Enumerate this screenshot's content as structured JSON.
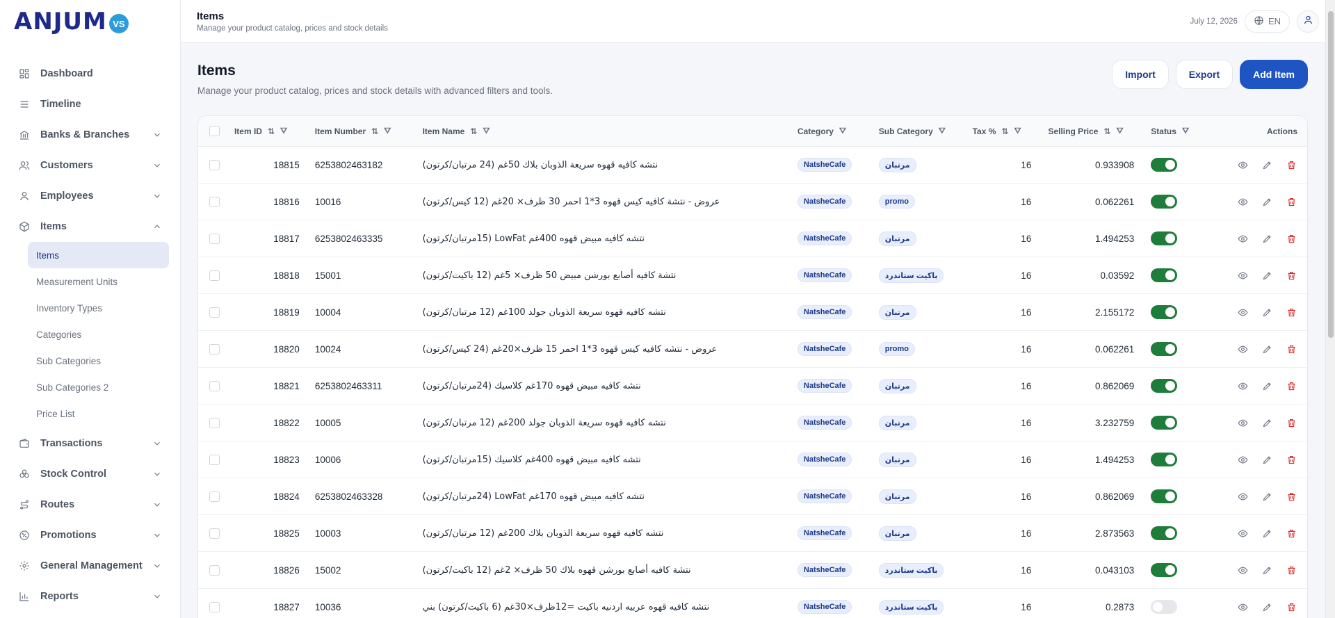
{
  "logo": {
    "text": "ANJUM",
    "badge": "VS"
  },
  "sidebar": {
    "items": [
      {
        "label": "Dashboard",
        "icon": "dashboard-icon"
      },
      {
        "label": "Timeline",
        "icon": "list-icon"
      },
      {
        "label": "Banks & Branches",
        "icon": "bank-icon"
      },
      {
        "label": "Customers",
        "icon": "users-icon"
      },
      {
        "label": "Employees",
        "icon": "user-icon"
      },
      {
        "label": "Items",
        "icon": "box-icon"
      }
    ],
    "items_sub": [
      {
        "label": "Items"
      },
      {
        "label": "Measurement Units"
      },
      {
        "label": "Inventory Types"
      },
      {
        "label": "Categories"
      },
      {
        "label": "Sub Categories"
      },
      {
        "label": "Sub Categories 2"
      },
      {
        "label": "Price List"
      }
    ],
    "items_after": [
      {
        "label": "Transactions",
        "icon": "wallet-icon"
      },
      {
        "label": "Stock Control",
        "icon": "stock-icon"
      },
      {
        "label": "Routes",
        "icon": "route-icon"
      },
      {
        "label": "Promotions",
        "icon": "percent-icon"
      },
      {
        "label": "General Management",
        "icon": "gear-icon"
      },
      {
        "label": "Reports",
        "icon": "chart-icon"
      }
    ]
  },
  "topbar": {
    "title": "Items",
    "subtitle": "Manage your product catalog, prices and stock details",
    "date": "July 12, 2026",
    "lang": "EN"
  },
  "page": {
    "title": "Items",
    "subtitle": "Manage your product catalog, prices and stock details with advanced filters and tools.",
    "import_label": "Import",
    "export_label": "Export",
    "add_label": "Add Item"
  },
  "table": {
    "headers": {
      "item_id": "Item ID",
      "item_number": "Item Number",
      "item_name": "Item Name",
      "category": "Category",
      "sub_category": "Sub Category",
      "tax": "Tax %",
      "price": "Selling Price",
      "status": "Status",
      "actions": "Actions"
    },
    "rows": [
      {
        "id": "18815",
        "number": "6253802463182",
        "name": "نتشه كافيه قهوه سريعة الذوبان بلاك 50غم (24 مرتبان/كرتون)",
        "category": "NatsheCafe",
        "sub": "مرتبان",
        "tax": "16",
        "price": "0.933908",
        "active": true
      },
      {
        "id": "18816",
        "number": "10016",
        "name": "عروض - نتشة كافيه كيس قهوه 3*1 احمر 30 ظرف× 20غم (12 كيس/كرتون)",
        "category": "NatsheCafe",
        "sub": "promo",
        "tax": "16",
        "price": "0.062261",
        "active": true
      },
      {
        "id": "18817",
        "number": "6253802463335",
        "name": "نتشه كافيه مبيض قهوه 400غم LowFat (15مرتبان/كرتون)",
        "category": "NatsheCafe",
        "sub": "مرتبان",
        "tax": "16",
        "price": "1.494253",
        "active": true
      },
      {
        "id": "18818",
        "number": "15001",
        "name": "نتشة كافيه أصابع بورشن مبيض 50 ظرف× 5غم (12 باكيت/كرتون)",
        "category": "NatsheCafe",
        "sub": "باكيت ستاندرد",
        "tax": "16",
        "price": "0.03592",
        "active": true
      },
      {
        "id": "18819",
        "number": "10004",
        "name": "نتشه كافيه قهوه سريعة الذوبان جولد 100غم (12 مرتبان/كرتون)",
        "category": "NatsheCafe",
        "sub": "مرتبان",
        "tax": "16",
        "price": "2.155172",
        "active": true
      },
      {
        "id": "18820",
        "number": "10024",
        "name": "عروض - نتشه كافيه كيس قهوه 3*1 احمر 15 ظرف×20غم (24 كيس/كرتون)",
        "category": "NatsheCafe",
        "sub": "promo",
        "tax": "16",
        "price": "0.062261",
        "active": true
      },
      {
        "id": "18821",
        "number": "6253802463311",
        "name": "نتشه كافيه مبيض قهوه 170غم كلاسيك (24مرتبان/كرتون)",
        "category": "NatsheCafe",
        "sub": "مرتبان",
        "tax": "16",
        "price": "0.862069",
        "active": true
      },
      {
        "id": "18822",
        "number": "10005",
        "name": "نتشه كافيه قهوه سريعة الذوبان جولد 200غم (12 مرتبان/كرتون)",
        "category": "NatsheCafe",
        "sub": "مرتبان",
        "tax": "16",
        "price": "3.232759",
        "active": true
      },
      {
        "id": "18823",
        "number": "10006",
        "name": "نتشه كافيه مبيض قهوه 400غم كلاسيك (15مرتبان/كرتون)",
        "category": "NatsheCafe",
        "sub": "مرتبان",
        "tax": "16",
        "price": "1.494253",
        "active": true
      },
      {
        "id": "18824",
        "number": "6253802463328",
        "name": "نتشه كافيه مبيض قهوه 170غم LowFat (24مرتبان/كرتون)",
        "category": "NatsheCafe",
        "sub": "مرتبان",
        "tax": "16",
        "price": "0.862069",
        "active": true
      },
      {
        "id": "18825",
        "number": "10003",
        "name": "نتشه كافيه قهوه سريعة الذوبان بلاك 200غم (12 مرتبان/كرتون)",
        "category": "NatsheCafe",
        "sub": "مرتبان",
        "tax": "16",
        "price": "2.873563",
        "active": true
      },
      {
        "id": "18826",
        "number": "15002",
        "name": "نتشة كافيه أصابع بورشن قهوه بلاك 50 ظرف× 2غم (12 باكيت/كرتون)",
        "category": "NatsheCafe",
        "sub": "باكيت ستاندرد",
        "tax": "16",
        "price": "0.043103",
        "active": true
      },
      {
        "id": "18827",
        "number": "10036",
        "name": "نتشه كافيه قهوه عربيه اردنيه باكيت =12ظرف×30غم (6 باكيت/كرتون) بني",
        "category": "NatsheCafe",
        "sub": "باكيت ستاندرد",
        "tax": "16",
        "price": "0.2873",
        "active": false
      }
    ]
  }
}
